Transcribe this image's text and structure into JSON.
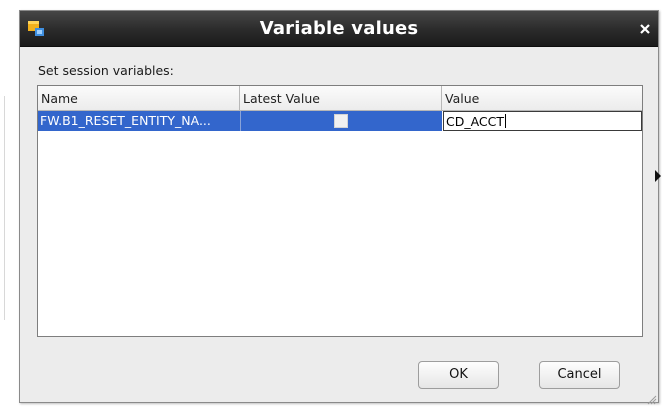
{
  "dialog": {
    "title": "Variable values",
    "section_label": "Set session variables:"
  },
  "table": {
    "columns": [
      "Name",
      "Latest Value",
      "Value"
    ],
    "rows": [
      {
        "name": "FW.B1_RESET_ENTITY_NA...",
        "latest_value_checked": false,
        "value": "CD_ACCT"
      }
    ]
  },
  "buttons": {
    "ok_label": "OK",
    "cancel_label": "Cancel"
  },
  "colors": {
    "titlebar": "#2a2a2a",
    "selection": "#3366cc",
    "dialog_bg": "#ececec"
  },
  "icons": [
    "app-icon",
    "close-icon",
    "resize-grip-icon"
  ]
}
